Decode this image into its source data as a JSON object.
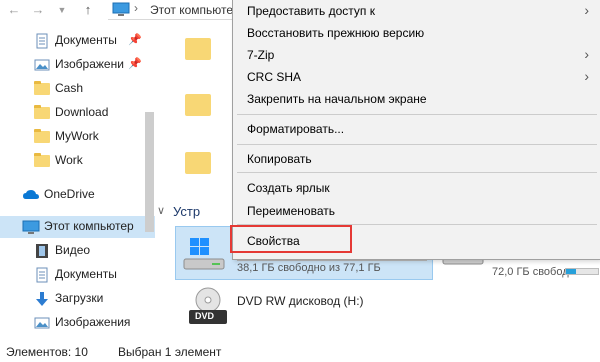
{
  "address": {
    "path": "Этот компьютер"
  },
  "sidebar": {
    "items": [
      {
        "label": "Документы",
        "icon": "documents-icon",
        "pinned": true
      },
      {
        "label": "Изображени",
        "icon": "pictures-icon",
        "pinned": true
      },
      {
        "label": "Cash",
        "icon": "folder-icon"
      },
      {
        "label": "Download",
        "icon": "folder-icon"
      },
      {
        "label": "MyWork",
        "icon": "folder-icon"
      },
      {
        "label": "Work",
        "icon": "folder-icon"
      },
      {
        "label": "OneDrive",
        "icon": "onedrive-icon"
      },
      {
        "label": "Этот компьютер",
        "icon": "computer-icon"
      },
      {
        "label": "Видео",
        "icon": "video-icon"
      },
      {
        "label": "Документы",
        "icon": "documents-icon"
      },
      {
        "label": "Загрузки",
        "icon": "downloads-icon"
      },
      {
        "label": "Изображения",
        "icon": "pictures-icon"
      }
    ]
  },
  "main": {
    "section_title": "Устр",
    "drive_c": {
      "caption": "38,1 ГБ свободно из 77,1 ГБ",
      "used_fraction": 0.51
    },
    "drive_d": {
      "caption": "72,0 ГБ свободно из",
      "used_fraction": 0.3
    },
    "dvd": {
      "label": "DVD RW дисковод (H:)",
      "badge": "DVD"
    }
  },
  "context_menu": {
    "items": [
      {
        "label": "Предоставить доступ к",
        "submenu": true
      },
      {
        "label": "Восстановить прежнюю версию",
        "submenu": false
      },
      {
        "label": "7-Zip",
        "submenu": true
      },
      {
        "label": "CRC SHA",
        "submenu": true
      },
      {
        "label": "Закрепить на начальном экране",
        "submenu": false
      },
      {
        "label": "Форматировать...",
        "submenu": false
      },
      {
        "label": "Копировать",
        "submenu": false
      },
      {
        "label": "Создать ярлык",
        "submenu": false
      },
      {
        "label": "Переименовать",
        "submenu": false
      },
      {
        "label": "Свойства",
        "submenu": false
      }
    ],
    "highlight_color": "#e53935"
  },
  "status": {
    "count": "Элементов: 10",
    "selected": "Выбран 1 элемент"
  },
  "colors": {
    "selection": "#cce4f7",
    "accent": "#26a0da"
  }
}
